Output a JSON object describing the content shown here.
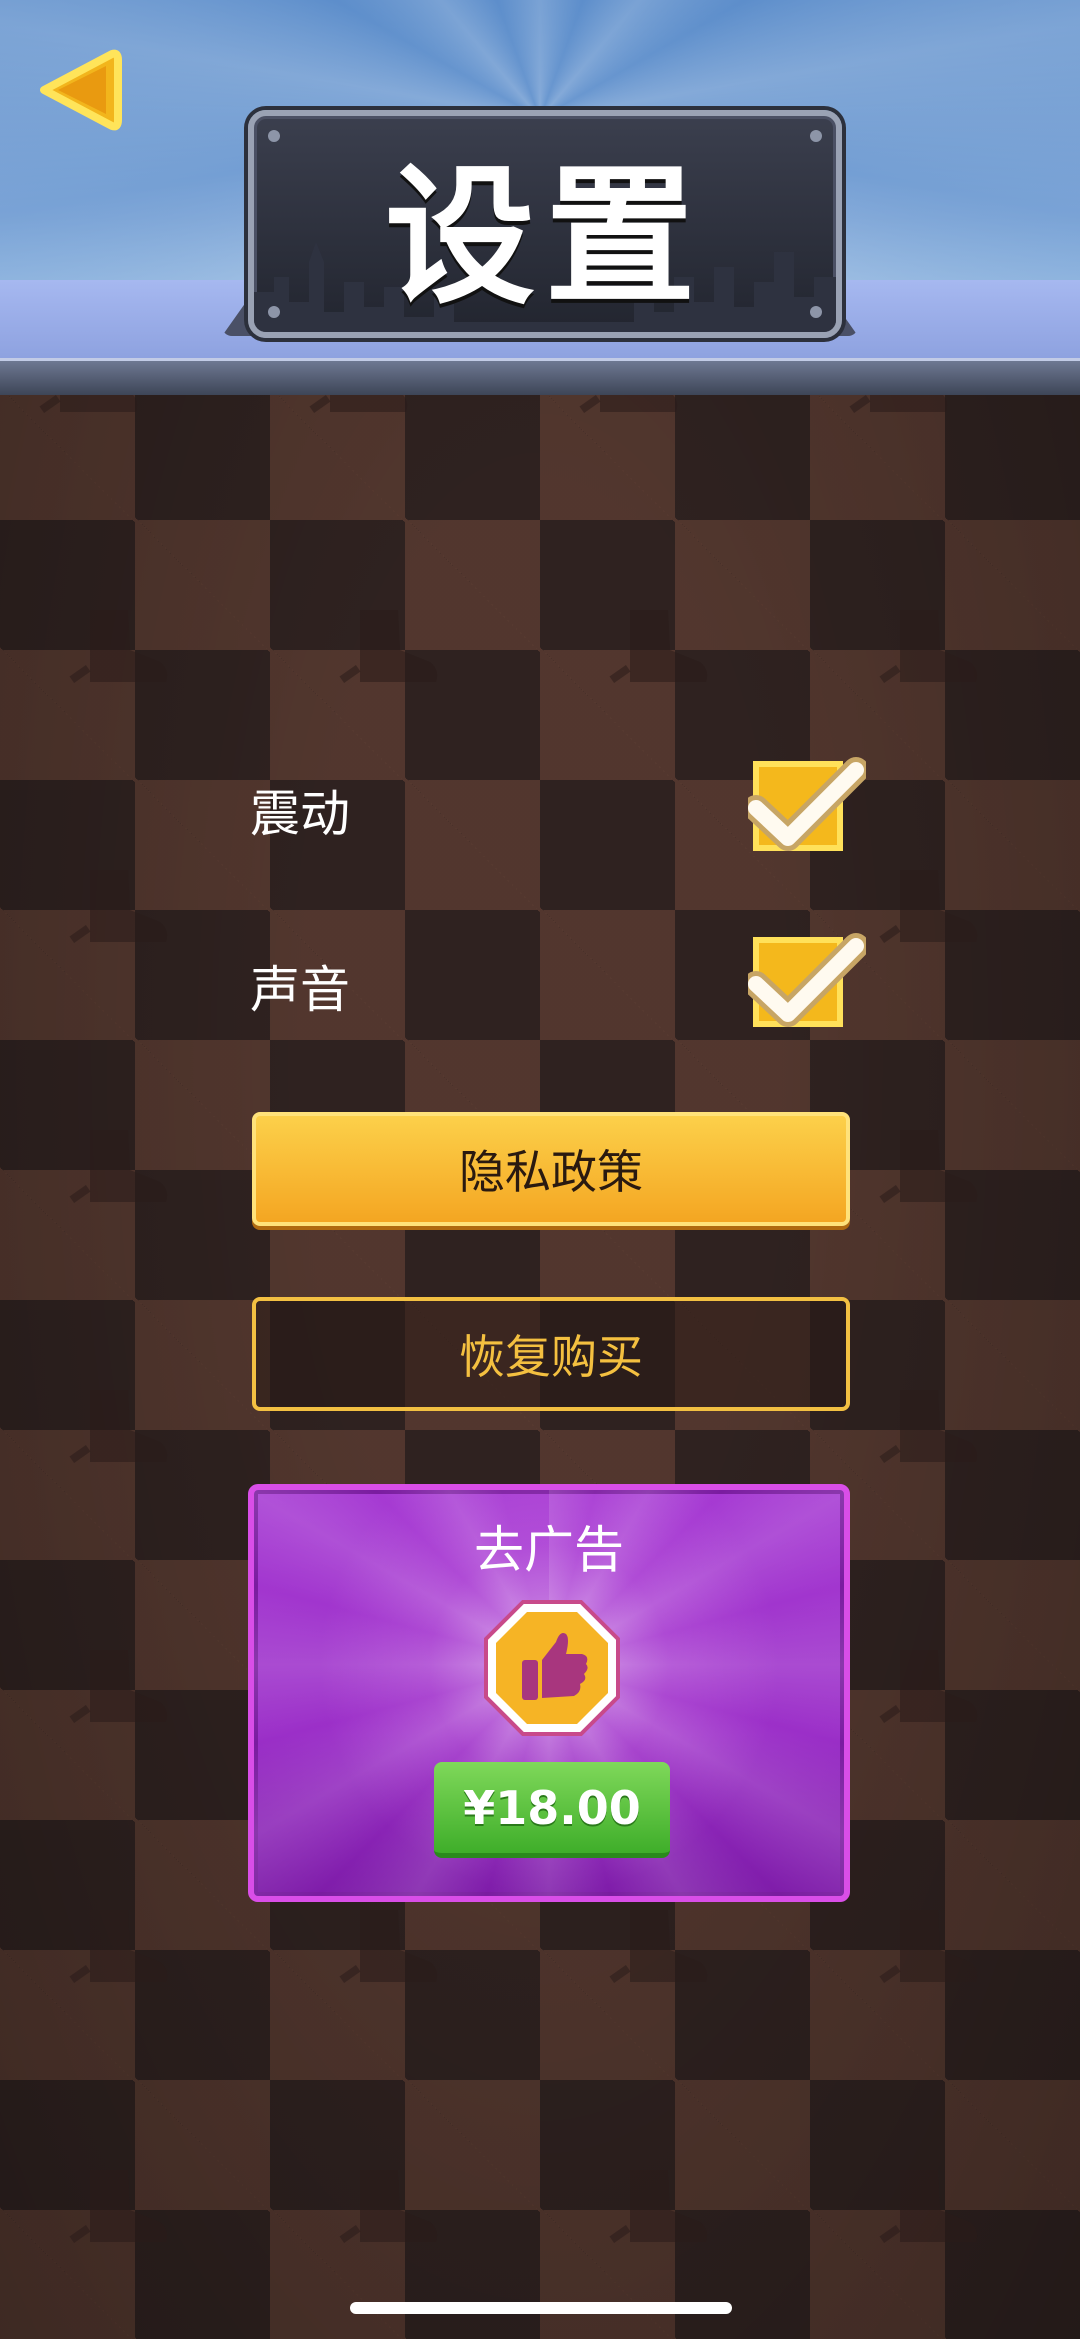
{
  "header": {
    "title": "设置",
    "back_icon": "back-arrow-icon"
  },
  "settings": [
    {
      "label": "震动",
      "checked": true
    },
    {
      "label": "声音",
      "checked": true
    }
  ],
  "buttons": {
    "privacy_label": "隐私政策",
    "restore_label": "恢复购买"
  },
  "remove_ads": {
    "title": "去广告",
    "icon": "thumbs-up-icon",
    "price": "¥18.00"
  },
  "colors": {
    "accent_gold": "#f4a622",
    "purple_card": "#9b2fc8",
    "price_green": "#3fae2a",
    "header_blue": "#7aa3d6"
  }
}
